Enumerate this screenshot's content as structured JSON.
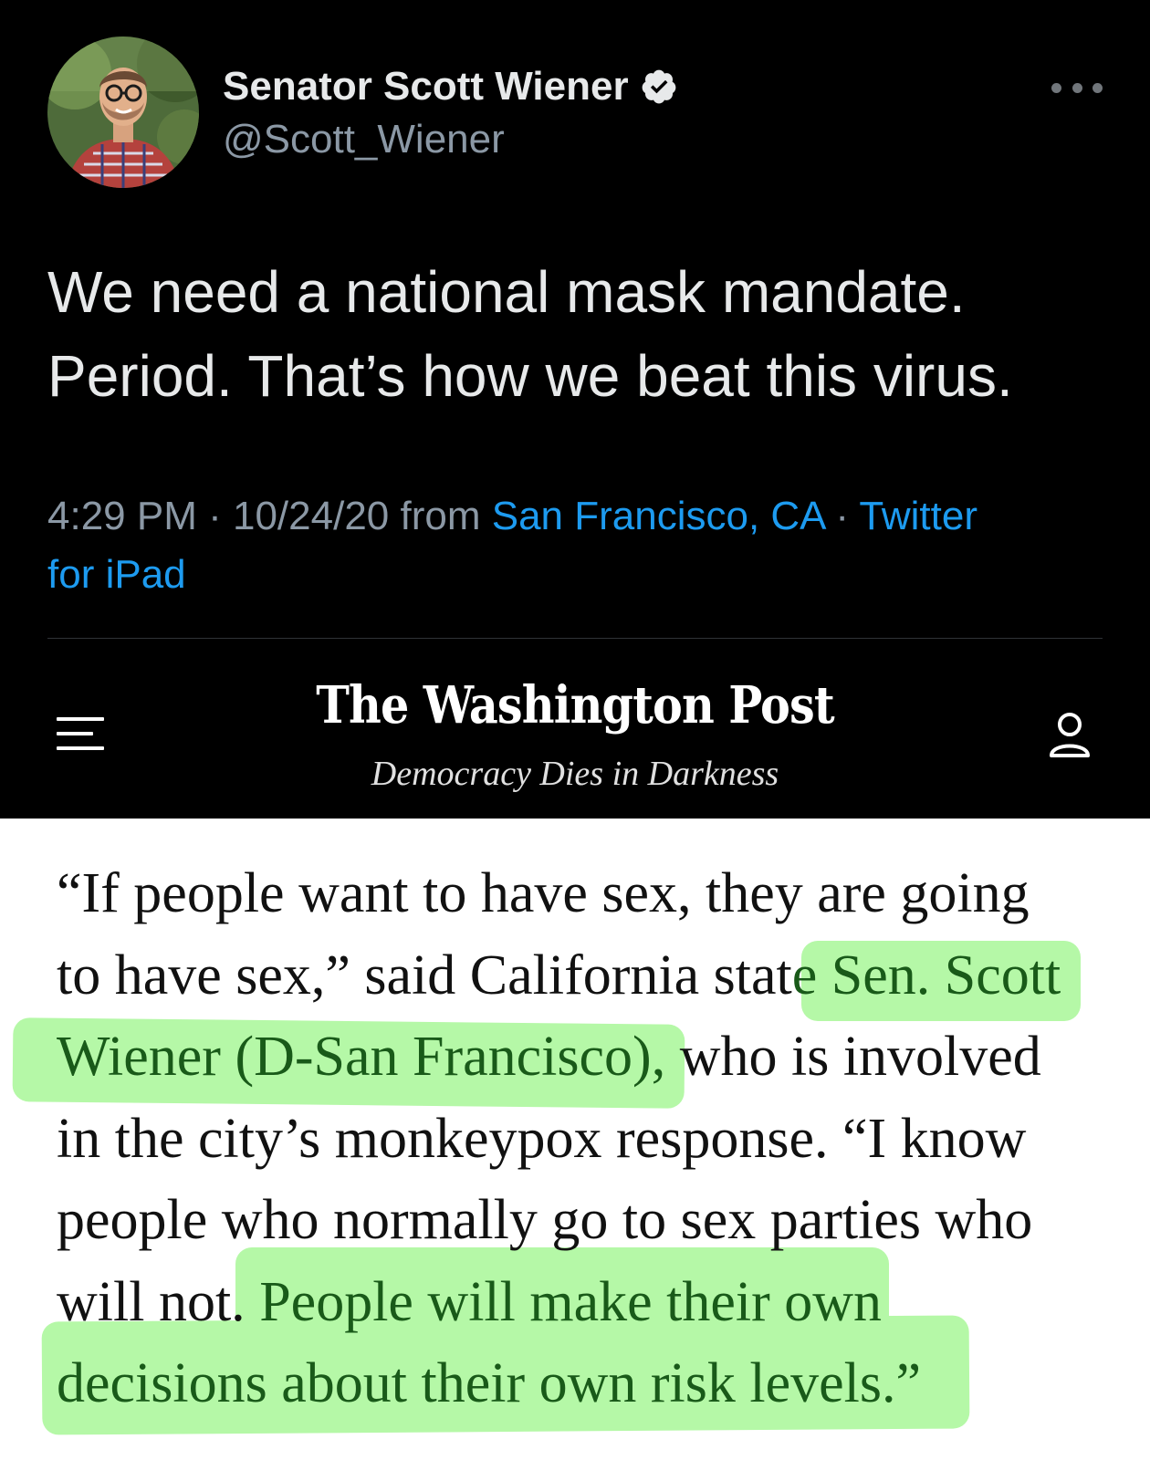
{
  "tweet": {
    "display_name": "Senator Scott Wiener",
    "handle": "@Scott_Wiener",
    "verified": true,
    "text_lines": [
      "We need a national mask mandate.",
      "Period. That’s how we beat this virus."
    ],
    "meta": {
      "time": "4:29 PM",
      "sep1": " · ",
      "date": "10/24/20",
      "from": " from ",
      "location": "San Francisco, CA",
      "sep2": " · ",
      "source_a": "Twitter",
      "source_b": "for iPad"
    },
    "icons": {
      "verified": "verified-badge-icon",
      "more": "more-horizontal-icon"
    },
    "colors": {
      "background": "#000000",
      "text": "#e7e9ea",
      "secondary": "#8b98a5",
      "link": "#1d9bf0"
    }
  },
  "wapo": {
    "masthead": "The Washington Post",
    "tagline": "Democracy Dies in Darkness",
    "icons": {
      "menu": "hamburger-menu-icon",
      "account": "user-icon"
    }
  },
  "article": {
    "lines": [
      {
        "parts": [
          {
            "t": "“If people want to have sex, they are going",
            "hl": false
          }
        ]
      },
      {
        "parts": [
          {
            "t": "to have sex,” said California stat",
            "hl": false
          },
          {
            "t": "e Sen. Scott",
            "hl": true
          }
        ]
      },
      {
        "parts": [
          {
            "t": "Wiener (D-San Francisco),",
            "hl": true
          },
          {
            "t": " who is involved",
            "hl": false
          }
        ]
      },
      {
        "parts": [
          {
            "t": "in the city’s monkeypox response. “I know",
            "hl": false
          }
        ]
      },
      {
        "parts": [
          {
            "t": "people who normally go to sex parties who",
            "hl": false
          }
        ]
      },
      {
        "parts": [
          {
            "t": "will not. ",
            "hl": false
          },
          {
            "t": "People will make their own",
            "hl": true
          }
        ]
      },
      {
        "parts": [
          {
            "t": "decisions about their own risk levels.”",
            "hl": true
          }
        ]
      }
    ],
    "colors": {
      "highlight": "#b5f8a7",
      "highlight_text": "#195a19",
      "text": "#111111"
    }
  }
}
